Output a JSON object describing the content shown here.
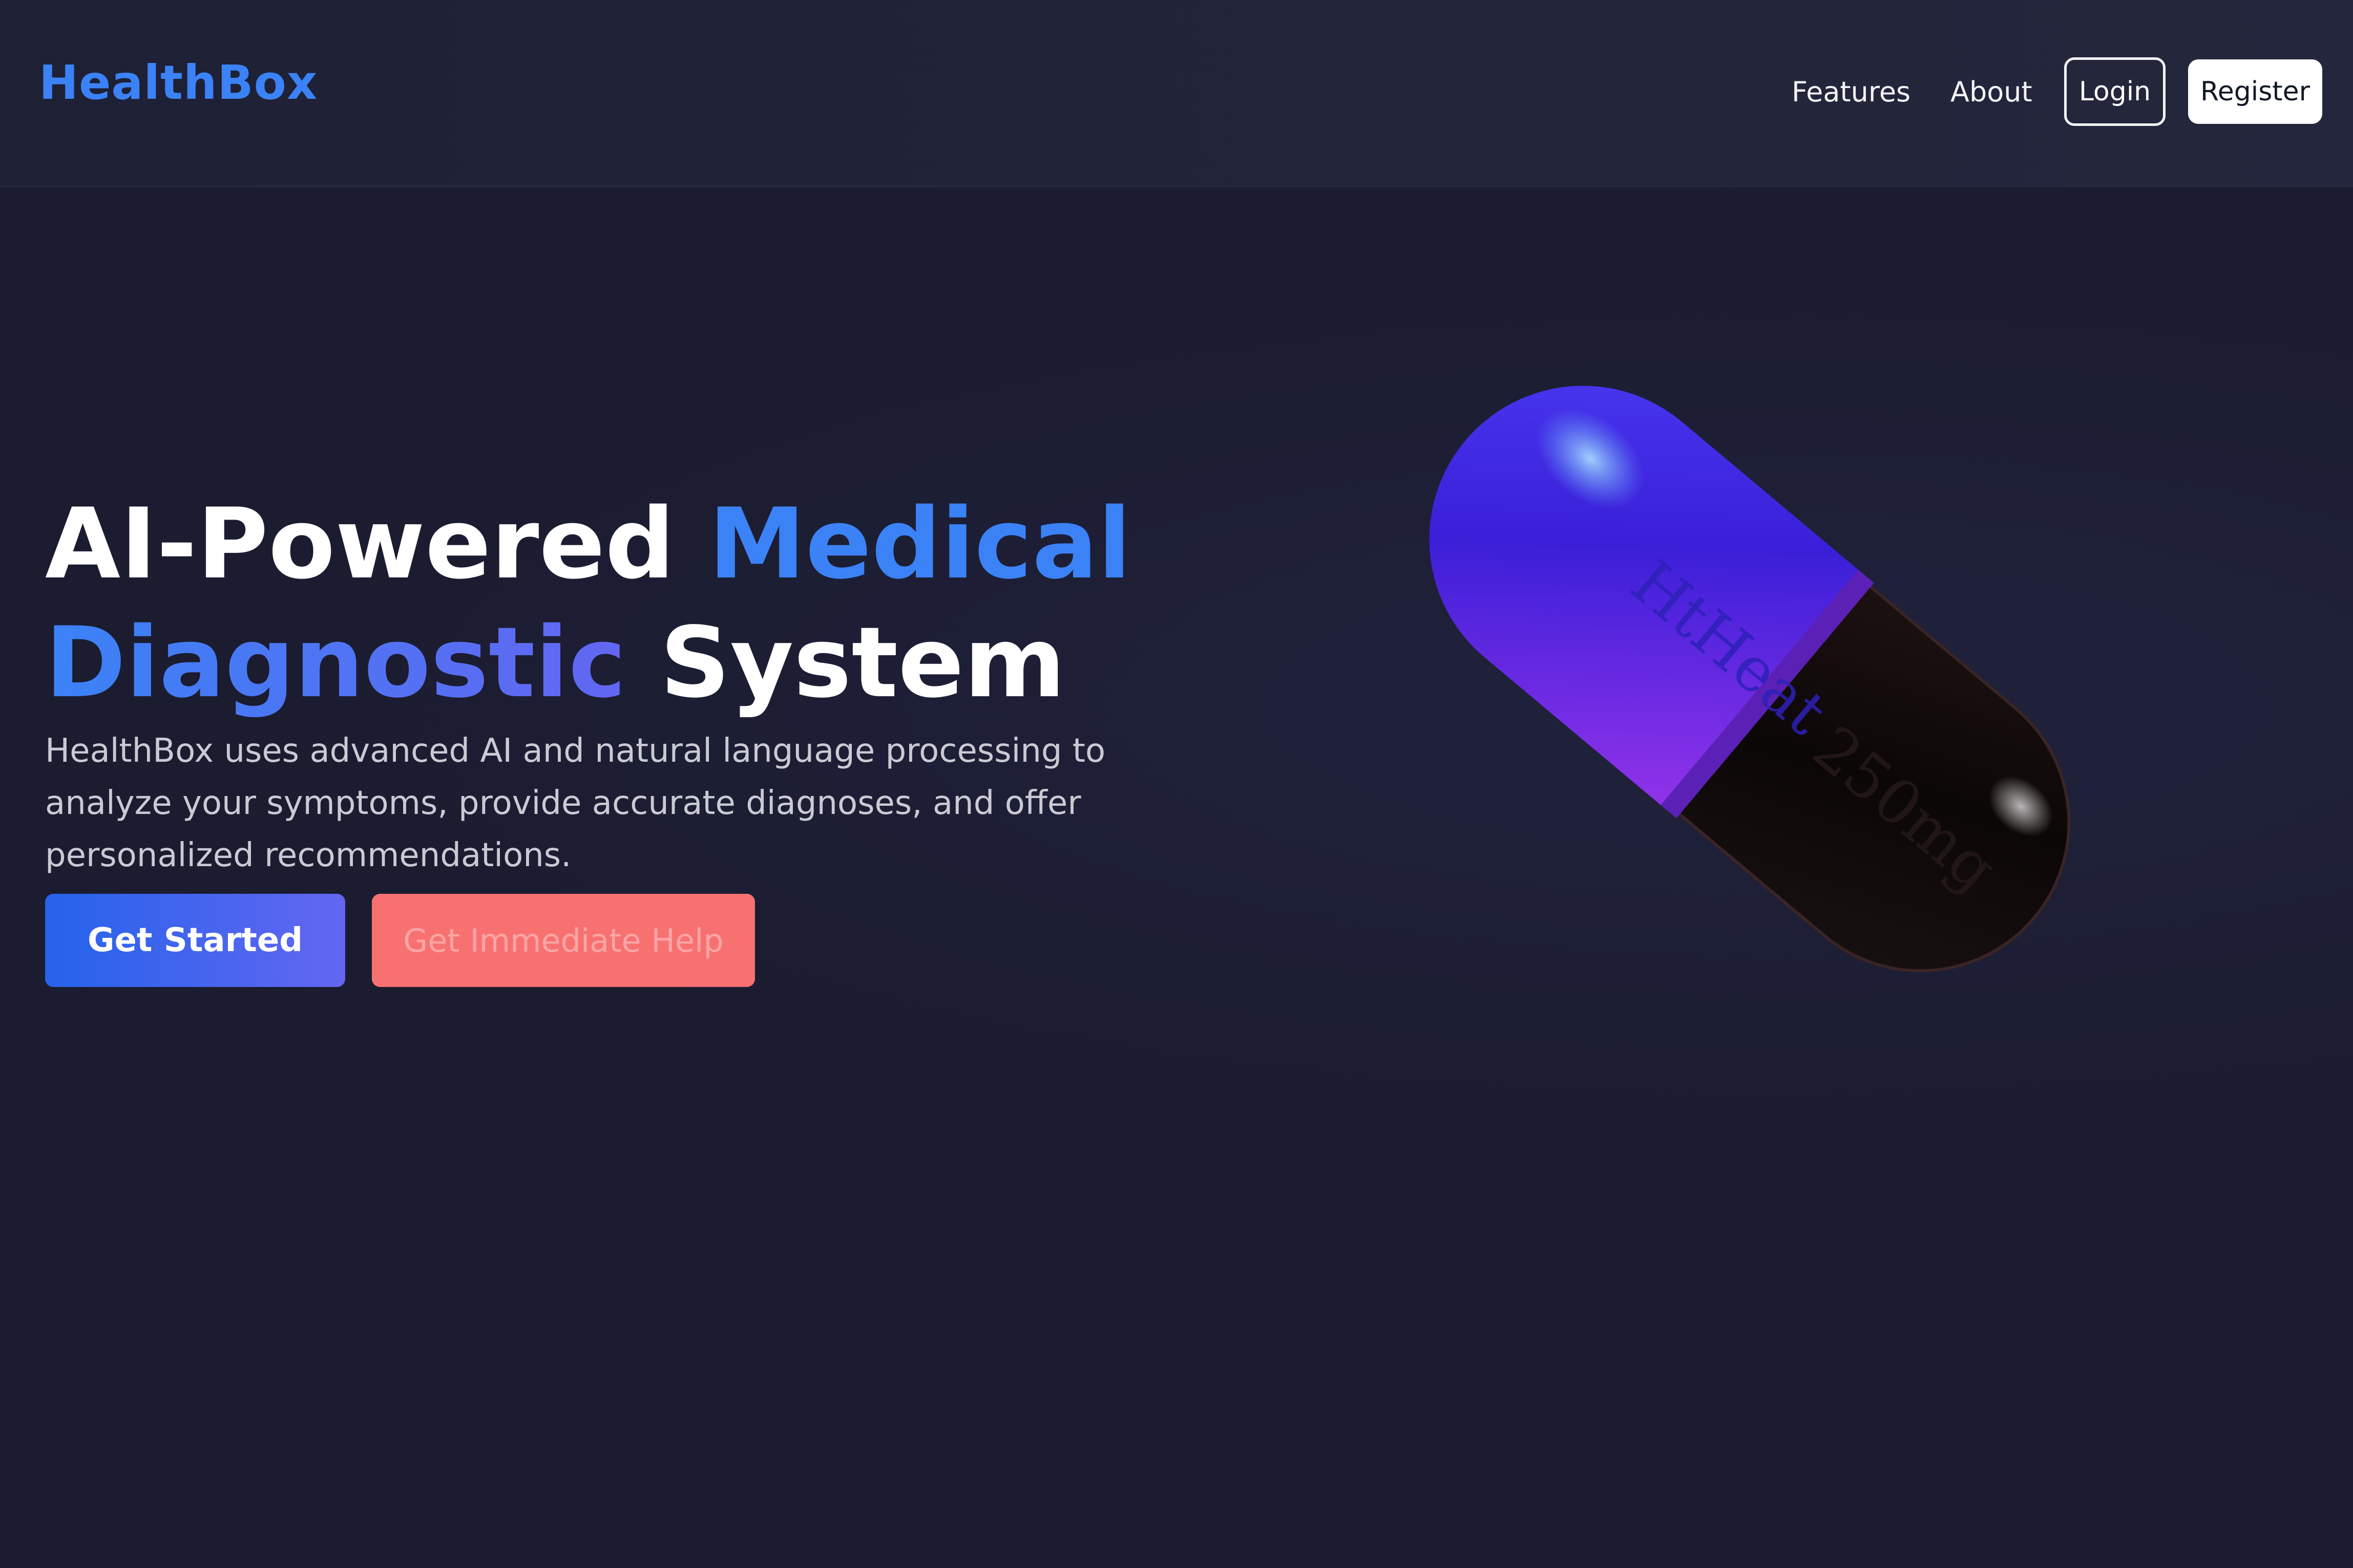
{
  "nav": {
    "logo": "HealthBox",
    "links": [
      "Features",
      "About"
    ],
    "login_label": "Login",
    "register_label": "Register"
  },
  "hero": {
    "title_part1": "AI-Powered",
    "title_part2": "Medical",
    "title_part3": "Diagnostic",
    "title_part4": "System",
    "description": "HealthBox uses advanced AI and natural language processing to analyze your symptoms, provide accurate diagnoses, and offer personalized recommendations.",
    "primary_button": "Get Started",
    "secondary_button": "Get Immediate Help",
    "image": {
      "type": "capsule-pill",
      "cap_text": "HtHeat",
      "body_text": "250mg",
      "colors": {
        "cap_gradient": [
          "#3b2cf0",
          "#6d28d9",
          "#9333ea"
        ],
        "body": "#140c0c"
      }
    }
  },
  "colors": {
    "background": "#1b1c30",
    "brand_blue": "#3b82f6",
    "accent_purple": "#6366f1",
    "help_red": "#f87171"
  }
}
